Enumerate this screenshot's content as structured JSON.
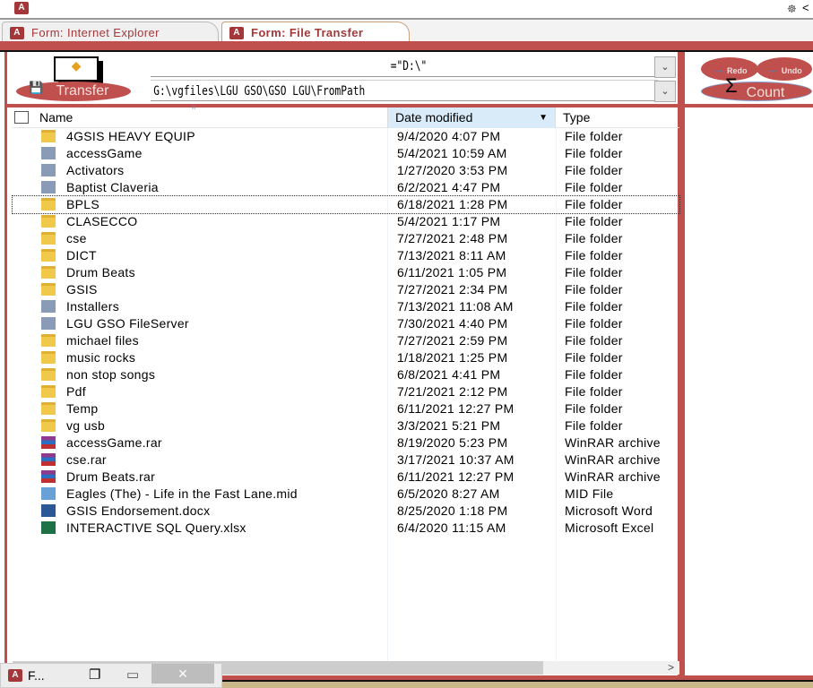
{
  "app": {
    "icon_label": "A",
    "corner_icon": "network-icon",
    "corner_chevron": "<"
  },
  "tabs": [
    {
      "label": "Form: Internet Explorer",
      "active": false
    },
    {
      "label": "Form: File Transfer",
      "active": true
    }
  ],
  "controls": {
    "drive_value": "=\"D:\\\"",
    "path_value": "G:\\vgfiles\\LGU GSO\\GSO LGU\\FromPath",
    "transfer_label": "Transfer",
    "redo_label": "Redo",
    "undo_label": "Undo",
    "count_label": "Count",
    "sigma": "Σ"
  },
  "columns": {
    "name": "Name",
    "date": "Date modified",
    "type": "Type"
  },
  "files": [
    {
      "name": "4GSIS HEAVY EQUIP",
      "date": "9/4/2020 4:07 PM",
      "type": "File folder",
      "icon": "folder"
    },
    {
      "name": "accessGame",
      "date": "5/4/2021 10:59 AM",
      "type": "File folder",
      "icon": "generic"
    },
    {
      "name": "Activators",
      "date": "1/27/2020 3:53 PM",
      "type": "File folder",
      "icon": "generic"
    },
    {
      "name": "Baptist Claveria",
      "date": "6/2/2021 4:47 PM",
      "type": "File folder",
      "icon": "generic"
    },
    {
      "name": "BPLS",
      "date": "6/18/2021 1:28 PM",
      "type": "File folder",
      "icon": "folder",
      "focused": true
    },
    {
      "name": "CLASECCO",
      "date": "5/4/2021 1:17 PM",
      "type": "File folder",
      "icon": "folder"
    },
    {
      "name": "cse",
      "date": "7/27/2021 2:48 PM",
      "type": "File folder",
      "icon": "folder"
    },
    {
      "name": "DICT",
      "date": "7/13/2021 8:11 AM",
      "type": "File folder",
      "icon": "folder"
    },
    {
      "name": "Drum Beats",
      "date": "6/11/2021 1:05 PM",
      "type": "File folder",
      "icon": "folder"
    },
    {
      "name": "GSIS",
      "date": "7/27/2021 2:34 PM",
      "type": "File folder",
      "icon": "folder"
    },
    {
      "name": "Installers",
      "date": "7/13/2021 11:08 AM",
      "type": "File folder",
      "icon": "generic"
    },
    {
      "name": "LGU GSO FileServer",
      "date": "7/30/2021 4:40 PM",
      "type": "File folder",
      "icon": "generic"
    },
    {
      "name": "michael files",
      "date": "7/27/2021 2:59 PM",
      "type": "File folder",
      "icon": "folder"
    },
    {
      "name": "music rocks",
      "date": "1/18/2021 1:25 PM",
      "type": "File folder",
      "icon": "folder"
    },
    {
      "name": "non stop songs",
      "date": "6/8/2021 4:41 PM",
      "type": "File folder",
      "icon": "folder"
    },
    {
      "name": "Pdf",
      "date": "7/21/2021 2:12 PM",
      "type": "File folder",
      "icon": "folder"
    },
    {
      "name": "Temp",
      "date": "6/11/2021 12:27 PM",
      "type": "File folder",
      "icon": "folder"
    },
    {
      "name": "vg usb",
      "date": "3/3/2021 5:21 PM",
      "type": "File folder",
      "icon": "folder"
    },
    {
      "name": "accessGame.rar",
      "date": "8/19/2020 5:23 PM",
      "type": "WinRAR archive",
      "icon": "rar"
    },
    {
      "name": "cse.rar",
      "date": "3/17/2021 10:37 AM",
      "type": "WinRAR archive",
      "icon": "rar"
    },
    {
      "name": "Drum Beats.rar",
      "date": "6/11/2021 12:27 PM",
      "type": "WinRAR archive",
      "icon": "rar"
    },
    {
      "name": "Eagles (The) - Life in the Fast Lane.mid",
      "date": "6/5/2020 8:27 AM",
      "type": "MID File",
      "icon": "mid"
    },
    {
      "name": "GSIS Endorsement.docx",
      "date": "8/25/2020 1:18 PM",
      "type": "Microsoft Word",
      "icon": "doc"
    },
    {
      "name": "INTERACTIVE SQL Query.xlsx",
      "date": "6/4/2020 11:15 AM",
      "type": "Microsoft Excel",
      "icon": "xls"
    }
  ],
  "minimized": {
    "title": "F...",
    "restore": "❐",
    "maximize": "▭",
    "close": "×"
  },
  "scroll": {
    "right_arrow": ">"
  }
}
